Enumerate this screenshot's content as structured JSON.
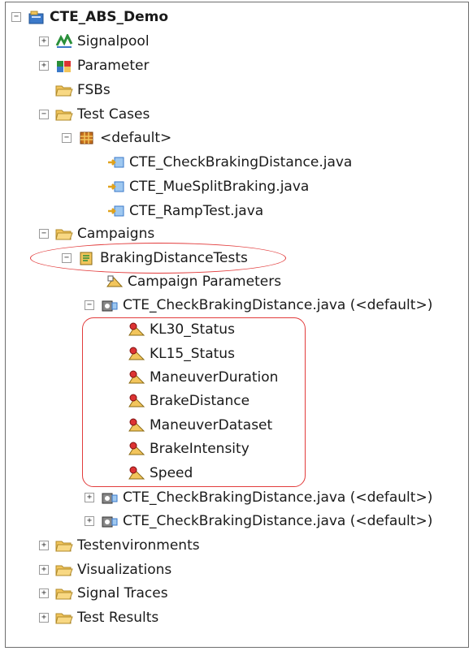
{
  "tree": {
    "root": "CTE_ABS_Demo",
    "signalpool": "Signalpool",
    "parameter": "Parameter",
    "fsbs": "FSBs",
    "test_cases": {
      "label": "Test Cases",
      "default_pkg": "<default>",
      "files": [
        "CTE_CheckBrakingDistance.java",
        "CTE_MueSplitBraking.java",
        "CTE_RampTest.java"
      ]
    },
    "campaigns": {
      "label": "Campaigns",
      "campaign": "BrakingDistanceTests",
      "campaign_parameters": "Campaign Parameters",
      "test_entries": [
        "CTE_CheckBrakingDistance.java (<default>)",
        "CTE_CheckBrakingDistance.java (<default>)",
        "CTE_CheckBrakingDistance.java (<default>)"
      ],
      "params": [
        "KL30_Status",
        "KL15_Status",
        "ManeuverDuration",
        "BrakeDistance",
        "ManeuverDataset",
        "BrakeIntensity",
        "Speed"
      ]
    },
    "testenvironments": "Testenvironments",
    "visualizations": "Visualizations",
    "signal_traces": "Signal Traces",
    "test_results": "Test Results",
    "expander_collapsed": "+",
    "expander_expanded": "−"
  },
  "colors": {
    "highlight": "#e23c3c",
    "folder": "#f2c55c",
    "border": "#6e6e6e"
  },
  "icons": {
    "project": "project-icon",
    "signalpool": "signalpool-icon",
    "parameter": "parameter-icon",
    "folder": "folder-icon",
    "package": "package-icon",
    "java_file": "java-file-icon",
    "campaign": "campaign-icon",
    "campaign_parameters": "campaign-parameters-icon",
    "test_entry": "test-entry-icon",
    "param": "param-icon"
  }
}
